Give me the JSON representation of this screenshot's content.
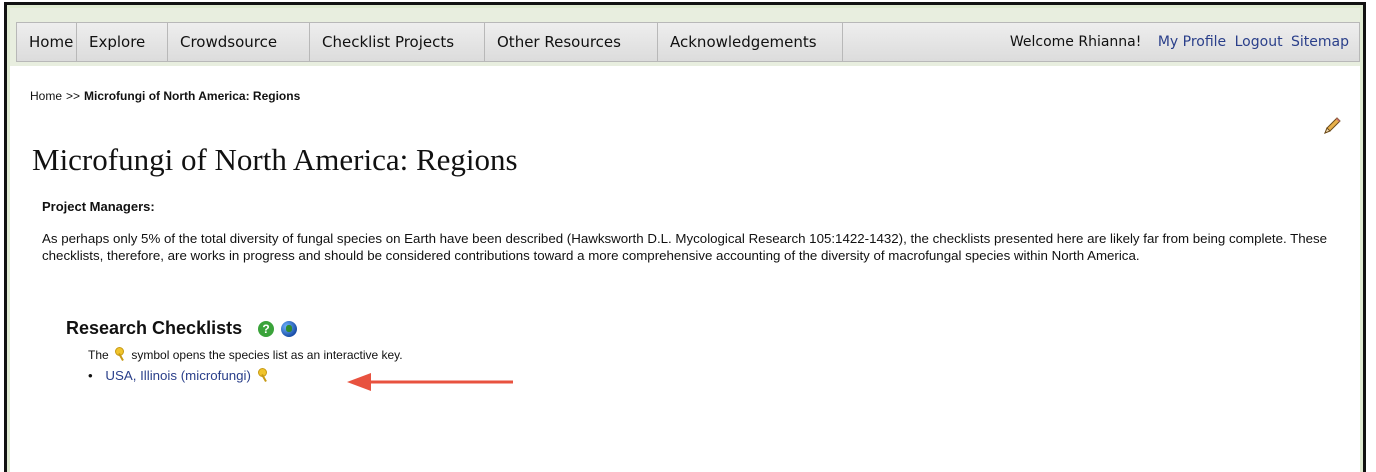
{
  "nav": {
    "tabs": [
      "Home",
      "Explore",
      "Crowdsource",
      "Checklist Projects",
      "Other Resources",
      "Acknowledgements"
    ],
    "welcome": "Welcome Rhianna!",
    "links": [
      "My Profile",
      "Logout",
      "Sitemap"
    ]
  },
  "breadcrumb": {
    "home": "Home",
    "separator": ">>",
    "current": "Microfungi of North America: Regions"
  },
  "page": {
    "title": "Microfungi of North America: Regions",
    "project_managers_label": "Project Managers:",
    "description": "As perhaps only 5% of the total diversity of fungal species on Earth have been described (Hawksworth D.L. Mycological Research 105:1422-1432), the checklists presented here are likely far from being complete. These checklists, therefore, are works in progress and should be considered contributions toward a more comprehensive accounting of the diversity of macrofungal species within North America."
  },
  "research": {
    "heading": "Research Checklists",
    "key_note_before": "The",
    "key_note_after": "symbol opens the species list as an interactive key.",
    "checklists": [
      "USA, Illinois (microfungi)"
    ]
  },
  "icons": {
    "edit": "pencil-icon",
    "help": "help-icon",
    "map": "globe-icon",
    "key": "key-icon",
    "annotation": "red-arrow"
  },
  "colors": {
    "link": "#2a3f8a",
    "nav_bg": "#e8eedf",
    "help_icon": "#3aa33a",
    "key_icon": "#f0c42c",
    "arrow": "#e8523f"
  }
}
